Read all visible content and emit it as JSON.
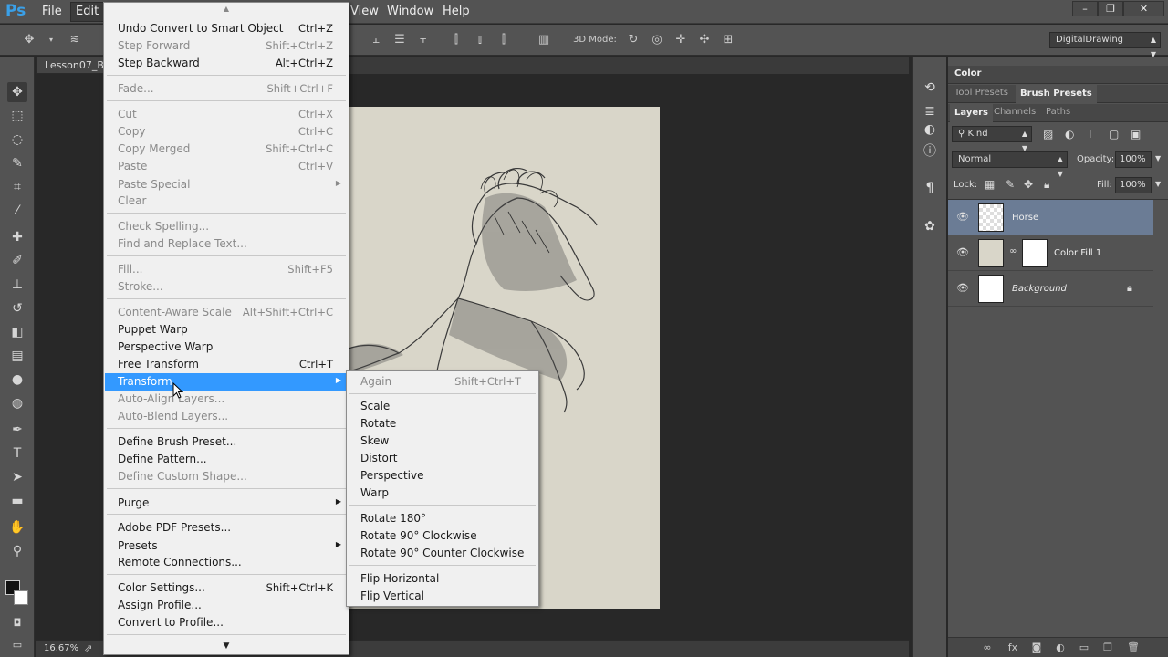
{
  "app": {
    "logo": "Ps"
  },
  "menubar": {
    "items": [
      "File",
      "Edit",
      "View",
      "Window",
      "Help"
    ],
    "window_buttons": [
      "–",
      "❐",
      "✕"
    ]
  },
  "options": {
    "mode3d_label": "3D Mode:",
    "workspace": "DigitalDrawing"
  },
  "document": {
    "tab_title": "Lesson07_B",
    "zoom": "16.67%"
  },
  "panels": {
    "row1_tabs": [
      "Color"
    ],
    "row2_tabs": [
      "Tool Presets",
      "Brush Presets"
    ],
    "layers_tabs": [
      "Layers",
      "Channels",
      "Paths"
    ],
    "kind_filter": "Kind",
    "blend_mode": "Normal",
    "opacity_label": "Opacity:",
    "opacity_value": "100%",
    "lock_label": "Lock:",
    "fill_label": "Fill:",
    "fill_value": "100%",
    "layers": [
      {
        "name": "Horse",
        "selected": true
      },
      {
        "name": "Color Fill 1",
        "selected": false
      },
      {
        "name": "Background",
        "selected": false
      }
    ]
  },
  "edit_menu": {
    "items": [
      {
        "label": "Undo Convert to Smart Object",
        "shortcut": "Ctrl+Z",
        "disabled": false
      },
      {
        "label": "Step Forward",
        "shortcut": "Shift+Ctrl+Z",
        "disabled": true
      },
      {
        "label": "Step Backward",
        "shortcut": "Alt+Ctrl+Z",
        "disabled": false
      },
      {
        "label": "Fade...",
        "shortcut": "Shift+Ctrl+F",
        "disabled": true
      },
      {
        "label": "Cut",
        "shortcut": "Ctrl+X",
        "disabled": true
      },
      {
        "label": "Copy",
        "shortcut": "Ctrl+C",
        "disabled": true
      },
      {
        "label": "Copy Merged",
        "shortcut": "Shift+Ctrl+C",
        "disabled": true
      },
      {
        "label": "Paste",
        "shortcut": "Ctrl+V",
        "disabled": true
      },
      {
        "label": "Paste Special",
        "shortcut": "",
        "disabled": true
      },
      {
        "label": "Clear",
        "shortcut": "",
        "disabled": true
      },
      {
        "label": "Check Spelling...",
        "shortcut": "",
        "disabled": true
      },
      {
        "label": "Find and Replace Text...",
        "shortcut": "",
        "disabled": true
      },
      {
        "label": "Fill...",
        "shortcut": "Shift+F5",
        "disabled": true
      },
      {
        "label": "Stroke...",
        "shortcut": "",
        "disabled": true
      },
      {
        "label": "Content-Aware Scale",
        "shortcut": "Alt+Shift+Ctrl+C",
        "disabled": true
      },
      {
        "label": "Puppet Warp",
        "shortcut": "",
        "disabled": false
      },
      {
        "label": "Perspective Warp",
        "shortcut": "",
        "disabled": false
      },
      {
        "label": "Free Transform",
        "shortcut": "Ctrl+T",
        "disabled": false
      },
      {
        "label": "Transform",
        "shortcut": "",
        "disabled": false
      },
      {
        "label": "Auto-Align Layers...",
        "shortcut": "",
        "disabled": true
      },
      {
        "label": "Auto-Blend Layers...",
        "shortcut": "",
        "disabled": true
      },
      {
        "label": "Define Brush Preset...",
        "shortcut": "",
        "disabled": false
      },
      {
        "label": "Define Pattern...",
        "shortcut": "",
        "disabled": false
      },
      {
        "label": "Define Custom Shape...",
        "shortcut": "",
        "disabled": true
      },
      {
        "label": "Purge",
        "shortcut": "",
        "disabled": false
      },
      {
        "label": "Adobe PDF Presets...",
        "shortcut": "",
        "disabled": false
      },
      {
        "label": "Presets",
        "shortcut": "",
        "disabled": false
      },
      {
        "label": "Remote Connections...",
        "shortcut": "",
        "disabled": false
      },
      {
        "label": "Color Settings...",
        "shortcut": "Shift+Ctrl+K",
        "disabled": false
      },
      {
        "label": "Assign Profile...",
        "shortcut": "",
        "disabled": false
      },
      {
        "label": "Convert to Profile...",
        "shortcut": "",
        "disabled": false
      }
    ]
  },
  "transform_menu": {
    "items": [
      {
        "label": "Again",
        "shortcut": "Shift+Ctrl+T",
        "disabled": true
      },
      {
        "label": "Scale",
        "shortcut": "",
        "disabled": false
      },
      {
        "label": "Rotate",
        "shortcut": "",
        "disabled": false
      },
      {
        "label": "Skew",
        "shortcut": "",
        "disabled": false
      },
      {
        "label": "Distort",
        "shortcut": "",
        "disabled": false
      },
      {
        "label": "Perspective",
        "shortcut": "",
        "disabled": false
      },
      {
        "label": "Warp",
        "shortcut": "",
        "disabled": false
      },
      {
        "label": "Rotate 180°",
        "shortcut": "",
        "disabled": false
      },
      {
        "label": "Rotate 90° Clockwise",
        "shortcut": "",
        "disabled": false
      },
      {
        "label": "Rotate 90° Counter Clockwise",
        "shortcut": "",
        "disabled": false
      },
      {
        "label": "Flip Horizontal",
        "shortcut": "",
        "disabled": false
      },
      {
        "label": "Flip Vertical",
        "shortcut": "",
        "disabled": false
      }
    ]
  }
}
